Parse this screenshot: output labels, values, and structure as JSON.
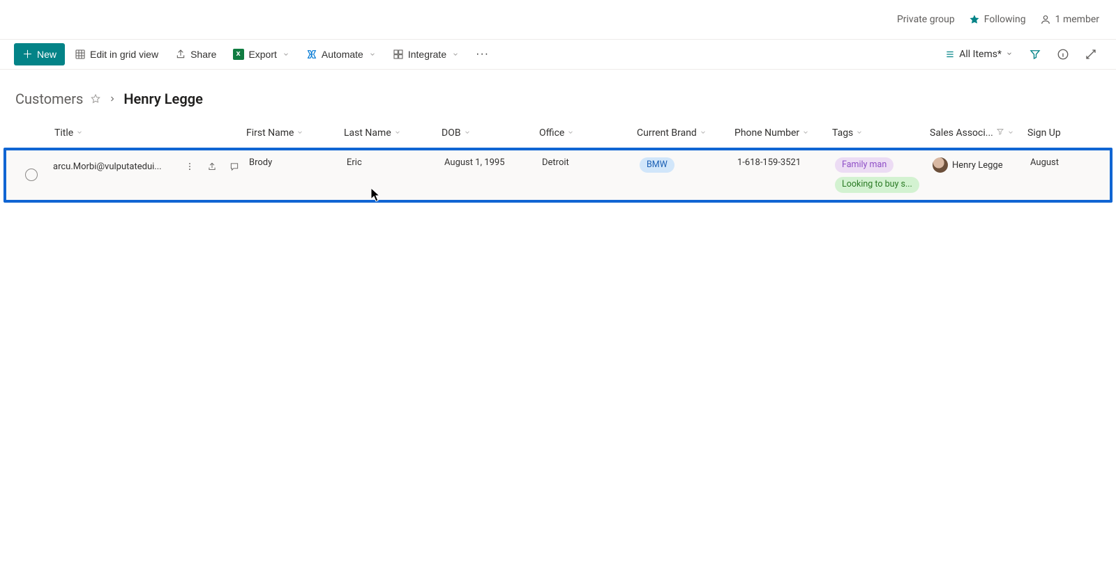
{
  "info_bar": {
    "privacy": "Private group",
    "following": "Following",
    "members": "1 member"
  },
  "command_bar": {
    "new": "New",
    "edit_grid": "Edit in grid view",
    "share": "Share",
    "export": "Export",
    "automate": "Automate",
    "integrate": "Integrate",
    "view_name": "All Items*"
  },
  "breadcrumb": {
    "root": "Customers",
    "current": "Henry Legge"
  },
  "columns": {
    "title": "Title",
    "first": "First Name",
    "last": "Last Name",
    "dob": "DOB",
    "office": "Office",
    "brand": "Current Brand",
    "phone": "Phone Number",
    "tags": "Tags",
    "assoc": "Sales Associ...",
    "signup": "Sign Up"
  },
  "row": {
    "title": "arcu.Morbi@vulputatedui...",
    "first": "Brody",
    "last": "Eric",
    "dob": "August 1, 1995",
    "office": "Detroit",
    "brand": "BMW",
    "phone": "1-618-159-3521",
    "tag1": "Family man",
    "tag2": "Looking to buy s...",
    "assoc": "Henry Legge",
    "signup": "August"
  }
}
